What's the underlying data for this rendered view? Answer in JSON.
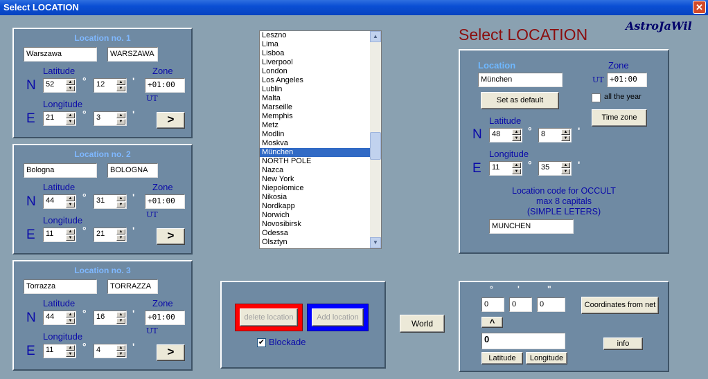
{
  "window": {
    "title": "Select LOCATION",
    "close": "✕"
  },
  "brand": "AstroJaWil",
  "heading": "Select LOCATION",
  "labels": {
    "latitude": "Latitude",
    "longitude": "Longitude",
    "zone": "Zone",
    "N": "N",
    "E": "E",
    "deg": "°",
    "min": "'",
    "sec": "\"",
    "ut": "UT",
    "go": ">"
  },
  "locations": [
    {
      "title": "Location no. 1",
      "name": "Warszawa",
      "code": "WARSZAWA",
      "lat_deg": "52",
      "lat_min": "12",
      "zone": "+01:00",
      "lon_deg": "21",
      "lon_min": "3"
    },
    {
      "title": "Location no. 2",
      "name": "Bologna",
      "code": "BOLOGNA",
      "lat_deg": "44",
      "lat_min": "31",
      "zone": "+01:00",
      "lon_deg": "11",
      "lon_min": "21"
    },
    {
      "title": "Location no. 3",
      "name": "Torrazza",
      "code": "TORRAZZA",
      "lat_deg": "44",
      "lat_min": "16",
      "zone": "+01:00",
      "lon_deg": "11",
      "lon_min": "4"
    }
  ],
  "city_list": {
    "items": [
      "Leszno",
      "Lima",
      "Lisboa",
      "Liverpool",
      "London",
      "Los Angeles",
      "Lublin",
      "Malta",
      "Marseille",
      "Memphis",
      "Metz",
      "Modlin",
      "Moskva",
      "München",
      "NORTH POLE",
      "Nazca",
      "New York",
      "Niepołomice",
      "Nikosia",
      "Nordkapp",
      "Norwich",
      "Novosibirsk",
      "Odessa",
      "Olsztyn"
    ],
    "selected": "München"
  },
  "edit_panel": {
    "delete_label": "delete location",
    "add_label": "Add location",
    "blockade_label": "Blockade",
    "blockade_checked": "✔"
  },
  "world_button": "World",
  "selected_location": {
    "location_label": "Location",
    "name": "München",
    "zone_label": "Zone",
    "zone": "+01:00",
    "set_default": "Set as default",
    "all_year": "all the year",
    "time_zone": "Time zone",
    "lat_deg": "48",
    "lat_min": "8",
    "lon_deg": "11",
    "lon_min": "35",
    "occult_line1": "Location code for OCCULT",
    "occult_line2": "max 8 capitals",
    "occult_line3": "(SIMPLE LETERS)",
    "occult_code": "MUNCHEN"
  },
  "converter": {
    "d": "0",
    "m": "0",
    "s": "0",
    "up": "^",
    "result": "0",
    "coords_from_net": "Coordinates from net",
    "info": "info",
    "latitude_btn": "Latitude",
    "longitude_btn": "Longitude"
  }
}
